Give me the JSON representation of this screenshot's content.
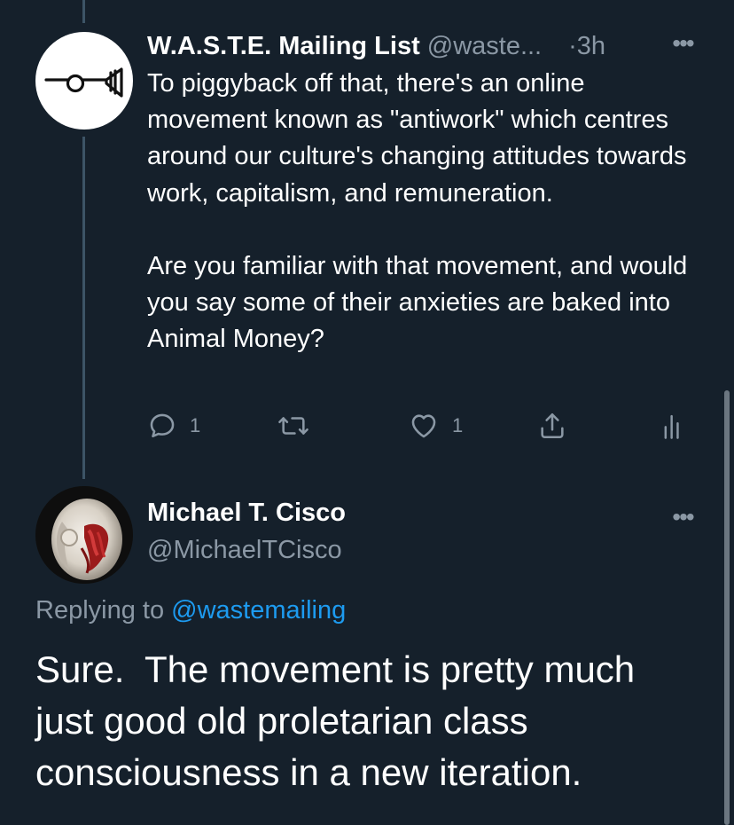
{
  "tweet1": {
    "display_name": "W.A.S.T.E. Mailing List",
    "handle": "@waste...",
    "timestamp": "·3h",
    "more_label": "•••",
    "avatar_icon": "waste-muted-post-horn-icon",
    "body_paragraphs": [
      "To piggyback off that, there's an online movement known as \"antiwork\" which centres around our culture's changing attitudes towards work, capitalism, and remuneration.",
      "Are you familiar with that movement, and would you say some of their anxieties are baked into Animal Money?"
    ],
    "actions": {
      "reply_count": "1",
      "retweet_count": "",
      "like_count": "1",
      "share_icon": "share-icon",
      "analytics_icon": "analytics-icon"
    }
  },
  "tweet2": {
    "display_name": "Michael T. Cisco",
    "handle": "@MichaelTCisco",
    "more_label": "•••",
    "replying_prefix": "Replying to",
    "replying_mention": "@wastemailing",
    "body": "Sure.  The movement is pretty much just good old proletarian class consciousness in a new iteration."
  },
  "colors": {
    "background": "#15202b",
    "text_primary": "#ffffff",
    "text_secondary": "#8b98a5",
    "accent": "#1d9bf0",
    "thread_line": "#3d5466"
  }
}
